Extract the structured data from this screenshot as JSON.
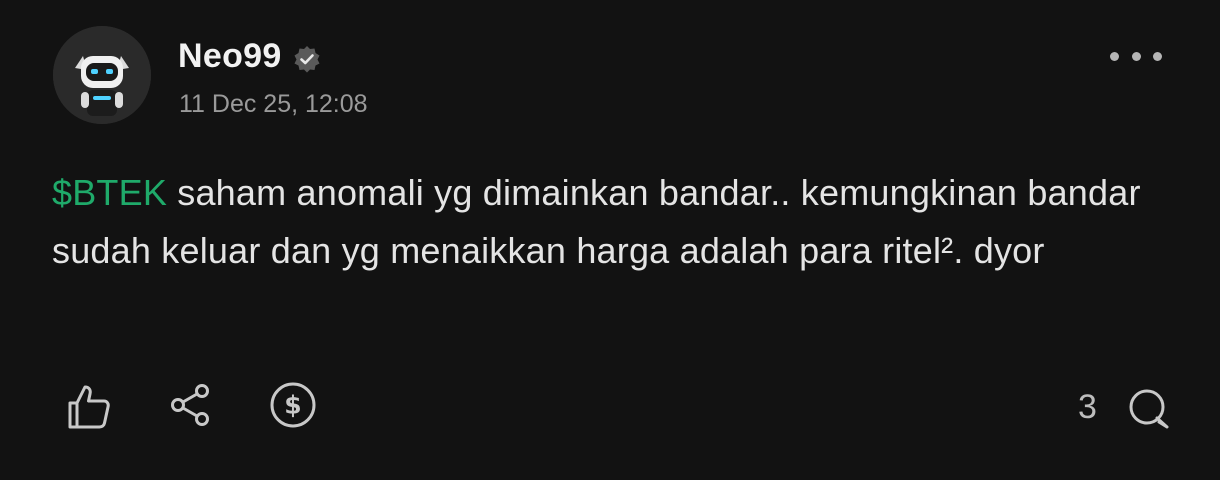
{
  "post": {
    "author": {
      "name": "Neo99",
      "verified": true,
      "avatar_icon": "robot-avatar"
    },
    "timestamp": "11 Dec 25, 12:08",
    "content": {
      "ticker": "$BTEK",
      "text": " saham anomali yg dimainkan bandar.. kemungkinan bandar sudah keluar dan yg menaikkan harga adalah para ritel². dyor"
    },
    "actions": {
      "like_icon": "thumbs-up-icon",
      "share_icon": "share-icon",
      "tip_icon": "dollar-coin-icon",
      "comment_icon": "comment-bubble-icon",
      "comment_count": "3"
    },
    "menu_icon": "more-options-icon",
    "colors": {
      "background": "#121212",
      "ticker": "#1faa6a",
      "text": "#e4e4e4",
      "muted": "#9a9a9a"
    }
  }
}
